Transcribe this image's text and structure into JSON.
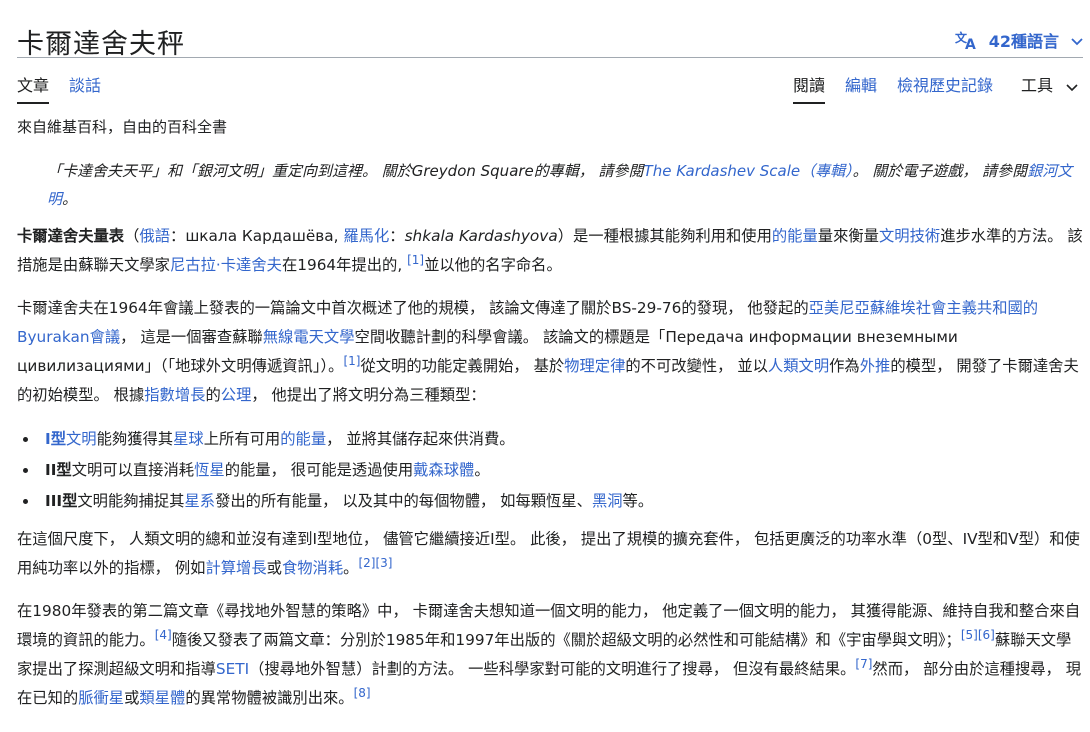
{
  "header": {
    "title": "卡爾達舍夫秤",
    "languages": "42種語言"
  },
  "tabs": {
    "article": "文章",
    "talk": "談話",
    "read": "閱讀",
    "edit": "編輯",
    "history": "檢視歷史記錄",
    "tools": "工具"
  },
  "subtitle": "來自維基百科，自由的百科全書",
  "hatnote": {
    "t1": "「卡達舍夫天平」和「銀河文明」重定向到這裡。 關於Greydon Square的專輯， 請參閱",
    "l1": "The Kardashev Scale（專輯）",
    "t2": "。 關於電子遊戲， 請參閱",
    "l2": "銀河文明",
    "t3": "。"
  },
  "p1": {
    "b1": "卡爾達舍夫量表",
    "t1": "（",
    "l1": "俄語",
    "t2": "：шкала Кардашёва, ",
    "l2": "羅馬化",
    "t3": "：",
    "i1": "shkala Kardashyova",
    "t4": "）是一種根據其能夠利用和使用",
    "l3": "的能量",
    "t5": "量來衡量",
    "l4": "文明技術",
    "t6": "進步水準的方法。 該措施是由蘇聯天文學家",
    "l5": "尼古拉·卡達舍夫",
    "t7": "在1964年提出的, ",
    "r1": "[1]",
    "t8": "並以他的名字命名。"
  },
  "p2": {
    "t1": "卡爾達舍夫在1964年會議上發表的一篇論文中首次概述了他的規模， 該論文傳達了關於BS-29-76的發現， 他發起的",
    "l1": "亞美尼亞蘇維埃社會主義共和國的Byurakan會議",
    "t2": "， 這是一個審查蘇聯",
    "l2": "無線電天文學",
    "t3": "空間收聽計劃的科學會議。 該論文的標題是「Передача информации внеземными цивилизациями」（「地球外文明傳遞資訊」）。",
    "r1": "[1]",
    "t4": "從文明的功能定義開始， 基於",
    "l3": "物理定律",
    "t5": "的不可改變性， 並以",
    "l4": "人類文明",
    "t6": "作為",
    "l5": "外推",
    "t7": "的模型， 開發了卡爾達舍夫的初始模型。 根據",
    "l6": "指數增長",
    "t8": "的",
    "l7": "公理",
    "t9": "， 他提出了將文明分為三種類型："
  },
  "bullets": [
    {
      "b": "I型",
      "l1": "文明",
      "t1": "能夠獲得其",
      "l2": "星球",
      "t2": "上所有可用",
      "l3": "的能量",
      "t3": "， 並將其儲存起來供消費。"
    },
    {
      "b": "II型",
      "t1": "文明可以直接消耗",
      "l1": "恆星",
      "t2": "的能量， 很可能是透過使用",
      "l2": "戴森球體",
      "t3": "。"
    },
    {
      "b": "III型",
      "t1": "文明能夠捕捉其",
      "l1": "星系",
      "t2": "發出的所有能量， 以及其中的每個物體， 如每顆恆星、",
      "l2": "黑洞",
      "t3": "等。"
    }
  ],
  "p3": {
    "t1": "在這個尺度下， 人類文明的總和並沒有達到I型地位， 儘管它繼續接近I型。 此後， 提出了規模的擴充套件， 包括更廣泛的功率水準（0型、IV型和V型）和使用純功率以外的指標， 例如",
    "l1": "計算增長",
    "t2": "或",
    "l2": "食物消耗",
    "t3": "。",
    "r1": "[2][3]"
  },
  "p4": {
    "t1": "在1980年發表的第二篇文章《尋找地外智慧的策略》中， 卡爾達舍夫想知道一個文明的能力， 他定義了一個文明的能力， 其獲得能源、維持自我和整合來自環境的資訊的能力。",
    "r1": "[4]",
    "t2": "隨後又發表了兩篇文章：分別於1985年和1997年出版的《關於超級文明的必然性和可能結構》和《宇宙學與文明》；",
    "r2": "[5][6]",
    "t3": "蘇聯天文學家提出了探測超級文明和指導",
    "l1": "SETI",
    "t4": "（搜尋地外智慧）計劃的方法。 一些科學家對可能的文明進行了搜尋， 但沒有最終結果。",
    "r3": "[7]",
    "t5": "然而， 部分由於這種搜尋， 現在已知的",
    "l2": "脈衝星",
    "t6": "或",
    "l3": "類星體",
    "t7": "的異常物體被識別出來。",
    "r4": "[8]"
  }
}
